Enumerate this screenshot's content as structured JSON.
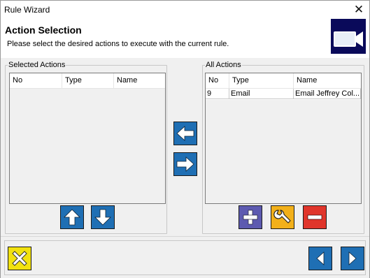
{
  "window": {
    "title": "Rule Wizard",
    "close_glyph": "✕"
  },
  "header": {
    "title": "Action Selection",
    "subtitle": "Please select the desired actions to execute with the current rule.",
    "logo_icon": "camera-icon"
  },
  "selected_actions": {
    "legend": "Selected Actions",
    "columns": [
      "No",
      "Type",
      "Name"
    ],
    "rows": []
  },
  "all_actions": {
    "legend": "All Actions",
    "columns": [
      "No",
      "Type",
      "Name"
    ],
    "rows": [
      {
        "no": "9",
        "type": "Email",
        "name": "Email Jeffrey Col..."
      }
    ]
  },
  "buttons": {
    "move_left_icon": "arrow-left-icon",
    "move_right_icon": "arrow-right-icon",
    "move_up_icon": "arrow-up-icon",
    "move_down_icon": "arrow-down-icon",
    "add_icon": "plus-icon",
    "edit_icon": "wrench-icon",
    "remove_icon": "minus-icon",
    "cancel_icon": "x-icon",
    "back_icon": "triangle-left-icon",
    "next_icon": "triangle-right-icon"
  },
  "colors": {
    "blue_button": "#1f6fb4",
    "purple_button": "#5d5ab0",
    "orange_button": "#f2b01a",
    "red_button": "#e0352b",
    "yellow_button": "#f1e10f",
    "logo_bg": "#0a0a5a"
  }
}
